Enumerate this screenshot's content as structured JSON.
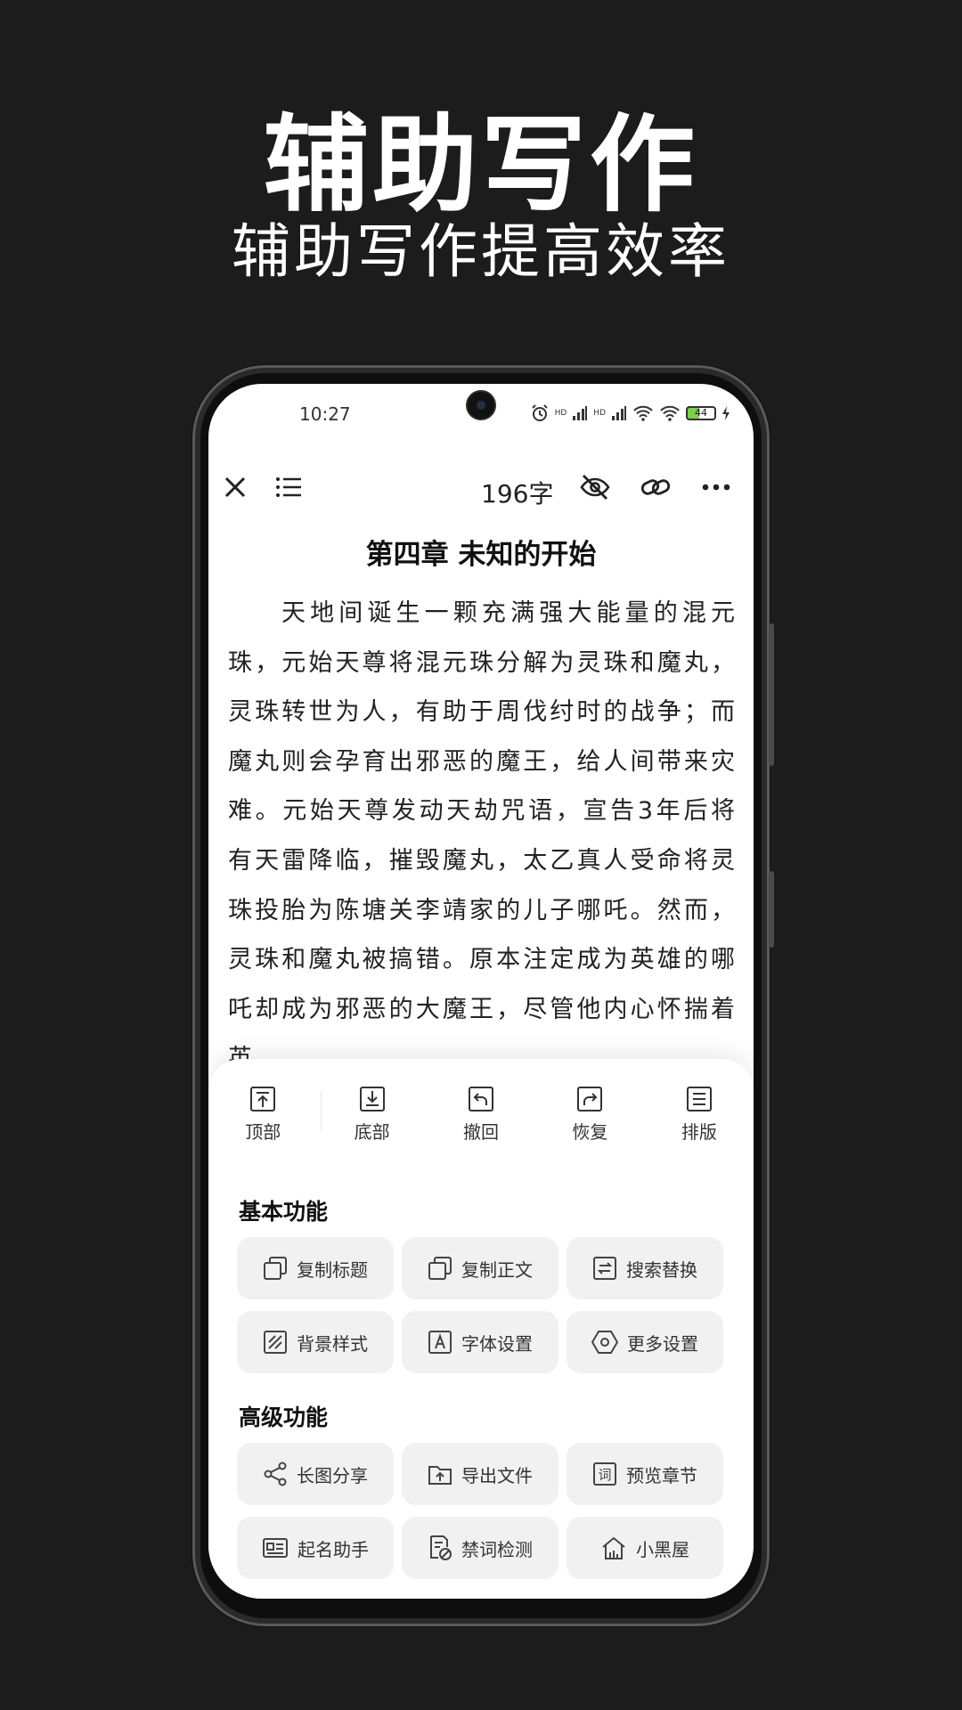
{
  "promo": {
    "title": "辅助写作",
    "subtitle": "辅助写作提高效率"
  },
  "statusbar": {
    "time": "10:27",
    "hd1": "HD",
    "hd2": "HD",
    "battery": "44"
  },
  "toolbar": {
    "word_count": "196字"
  },
  "document": {
    "title": "第四章 未知的开始",
    "body": "天地间诞生一颗充满强大能量的混元珠，元始天尊将混元珠分解为灵珠和魔丸，灵珠转世为人，有助于周伐纣时的战争；而魔丸则会孕育出邪恶的魔王，给人间带来灾难。元始天尊发动天劫咒语，宣告3年后将有天雷降临，摧毁魔丸，太乙真人受命将灵珠投胎为陈塘关李靖家的儿子哪吒。然而，灵珠和魔丸被搞错。原本注定成为英雄的哪吒却成为邪恶的大魔王，尽管他内心怀揣着英"
  },
  "quick_actions": [
    {
      "label": "顶部",
      "icon": "to-top-icon"
    },
    {
      "label": "底部",
      "icon": "to-bottom-icon"
    },
    {
      "label": "撤回",
      "icon": "undo-icon"
    },
    {
      "label": "恢复",
      "icon": "redo-icon"
    },
    {
      "label": "排版",
      "icon": "layout-icon"
    }
  ],
  "basic": {
    "title": "基本功能",
    "items": [
      {
        "label": "复制标题",
        "icon": "copy-icon"
      },
      {
        "label": "复制正文",
        "icon": "copy-icon"
      },
      {
        "label": "搜索替换",
        "icon": "swap-icon"
      },
      {
        "label": "背景样式",
        "icon": "background-icon"
      },
      {
        "label": "字体设置",
        "icon": "font-icon"
      },
      {
        "label": "更多设置",
        "icon": "hexagon-settings-icon"
      }
    ]
  },
  "advanced": {
    "title": "高级功能",
    "items": [
      {
        "label": "长图分享",
        "icon": "share-icon"
      },
      {
        "label": "导出文件",
        "icon": "export-file-icon"
      },
      {
        "label": "预览章节",
        "icon": "preview-icon"
      },
      {
        "label": "起名助手",
        "icon": "name-card-icon"
      },
      {
        "label": "禁词检测",
        "icon": "forbidden-check-icon"
      },
      {
        "label": "小黑屋",
        "icon": "house-icon"
      }
    ]
  },
  "colors": {
    "background": "#1c1c1c",
    "screen": "#ffffff",
    "button_bg": "#f1f1f1",
    "text": "#222222"
  }
}
